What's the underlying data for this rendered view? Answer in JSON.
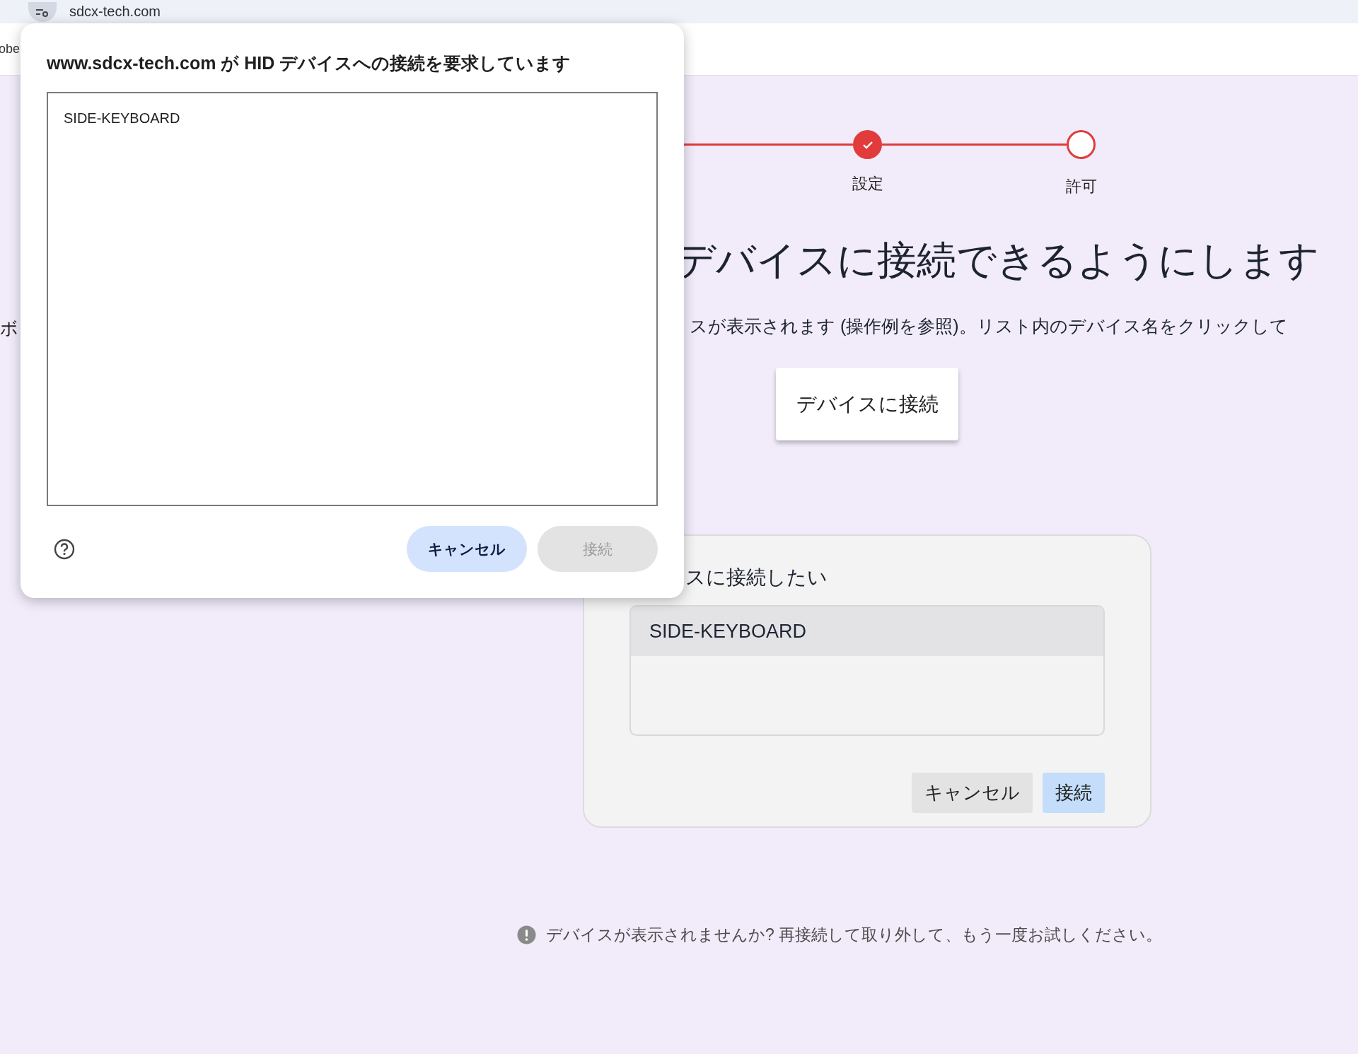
{
  "browser": {
    "url": "sdcx-tech.com",
    "bookmark_fragment": "obe"
  },
  "chooser_dialog": {
    "title": "www.sdcx-tech.com が HID デバイスへの接続を要求しています",
    "devices": [
      {
        "name": "SIDE-KEYBOARD",
        "selected": false
      }
    ],
    "buttons": [
      {
        "label": "キャンセル",
        "kind": "primary"
      },
      {
        "label": "接続",
        "kind": "disabled"
      }
    ]
  },
  "page": {
    "left_fragment": "ボ",
    "steps": [
      {
        "label": "設定",
        "completed": true
      },
      {
        "label": "許可",
        "completed": false
      }
    ],
    "heading": "デバイスに接続できるようにします",
    "instructions": "スが表示されます (操作例を参照)。リスト内のデバイス名をクリックして",
    "connect_button": "デバイスに接続",
    "example_card": {
      "title": "スに接続したい",
      "devices": [
        {
          "name": "SIDE-KEYBOARD",
          "selected": true
        }
      ],
      "buttons": [
        {
          "label": "キャンセル",
          "kind": "secondary"
        },
        {
          "label": "接続",
          "kind": "primary"
        }
      ]
    },
    "notice": "デバイスが表示されませんか? 再接続して取り外して、もう一度お試しください。"
  }
}
